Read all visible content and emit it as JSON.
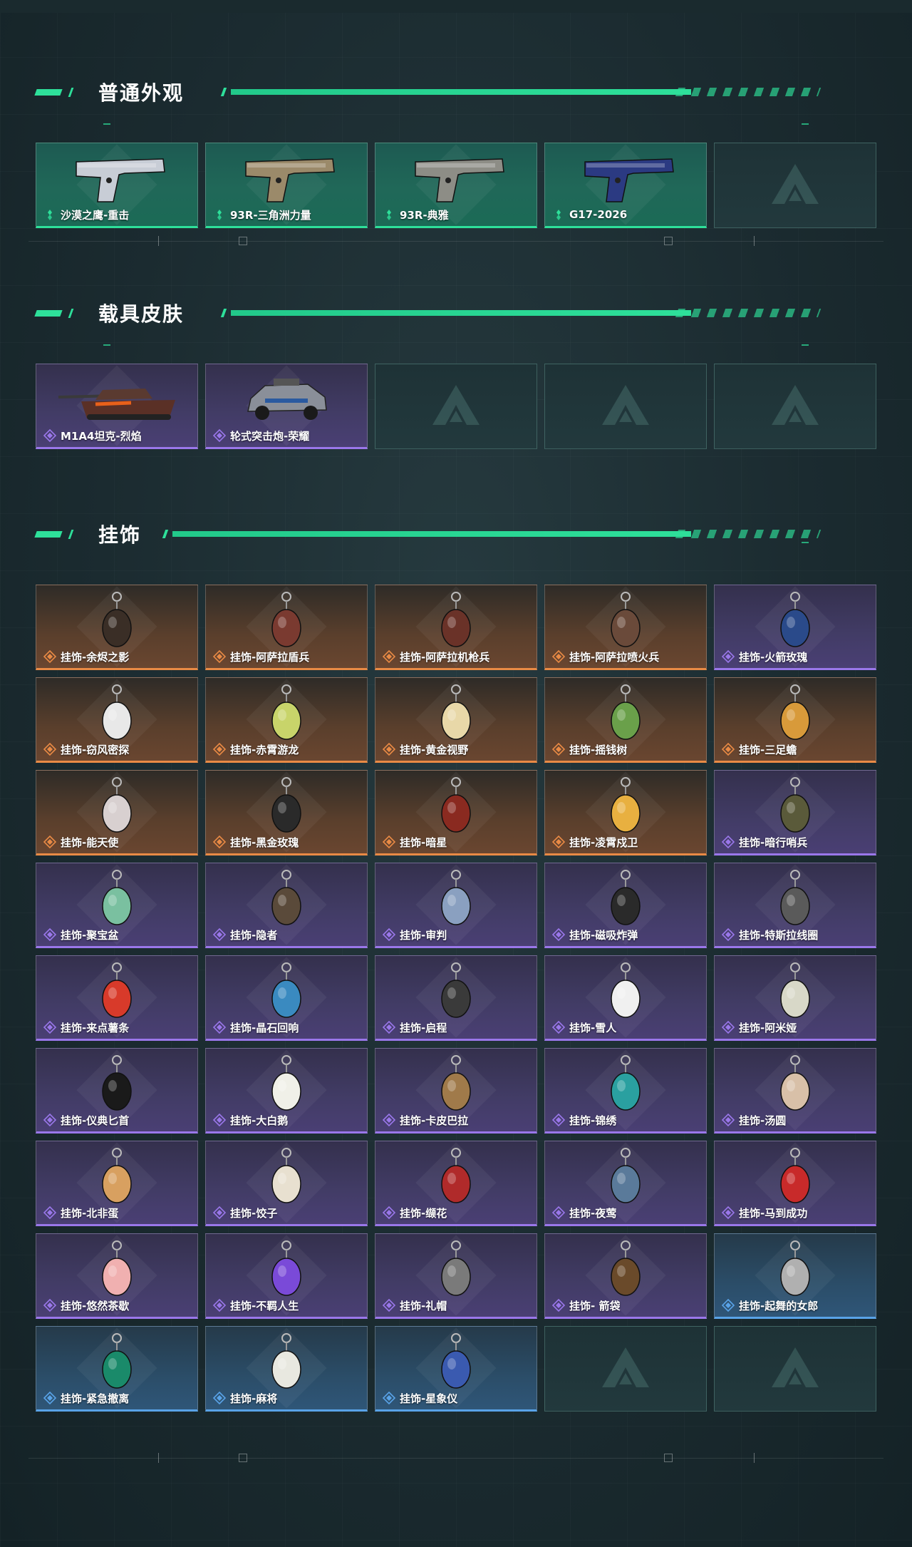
{
  "sections": [
    {
      "title": "普通外观",
      "items": [
        {
          "label": "沙漠之鹰-重击",
          "rarity": "green",
          "icon": "pistol-icon",
          "color": "#c8cdd6"
        },
        {
          "label": "93R-三角洲力量",
          "rarity": "green",
          "icon": "pistol-icon",
          "color": "#9b8a6a"
        },
        {
          "label": "93R-典雅",
          "rarity": "green",
          "icon": "pistol-icon",
          "color": "#8d8d86"
        },
        {
          "label": "G17-2026",
          "rarity": "green",
          "icon": "pistol-icon",
          "color": "#2b3a82"
        },
        {
          "label": "",
          "rarity": "empty",
          "icon": "logo-icon"
        }
      ]
    },
    {
      "title": "载具皮肤",
      "items": [
        {
          "label": "M1A4坦克-烈焰",
          "rarity": "purple",
          "icon": "tank-icon",
          "color": "#5a3a30"
        },
        {
          "label": "轮式突击炮-荣耀",
          "rarity": "purple",
          "icon": "vehicle-icon",
          "color": "#8a8f99"
        },
        {
          "label": "",
          "rarity": "empty",
          "icon": "logo-icon"
        },
        {
          "label": "",
          "rarity": "empty",
          "icon": "logo-icon"
        },
        {
          "label": "",
          "rarity": "empty",
          "icon": "logo-icon"
        }
      ]
    },
    {
      "title": "挂饰",
      "items": [
        {
          "label": "挂饰-余烬之影",
          "rarity": "orange",
          "icon": "charm-icon",
          "color": "#3a2e26"
        },
        {
          "label": "挂饰-阿萨拉盾兵",
          "rarity": "orange",
          "icon": "charm-icon",
          "color": "#7a3a30"
        },
        {
          "label": "挂饰-阿萨拉机枪兵",
          "rarity": "orange",
          "icon": "charm-icon",
          "color": "#6a3228"
        },
        {
          "label": "挂饰-阿萨拉喷火兵",
          "rarity": "orange",
          "icon": "charm-icon",
          "color": "#6a4a3a"
        },
        {
          "label": "挂饰-火箭玫瑰",
          "rarity": "purple",
          "icon": "charm-icon",
          "color": "#2a4a8a"
        },
        {
          "label": "挂饰-窃风密探",
          "rarity": "orange",
          "icon": "charm-icon",
          "color": "#e8e8e8"
        },
        {
          "label": "挂饰-赤霄游龙",
          "rarity": "orange",
          "icon": "charm-icon",
          "color": "#c8d46a"
        },
        {
          "label": "挂饰-黄金视野",
          "rarity": "orange",
          "icon": "charm-icon",
          "color": "#e8d8a8"
        },
        {
          "label": "挂饰-摇钱树",
          "rarity": "orange",
          "icon": "charm-icon",
          "color": "#6aa04a"
        },
        {
          "label": "挂饰-三足蟾",
          "rarity": "orange",
          "icon": "charm-icon",
          "color": "#d89a3a"
        },
        {
          "label": "挂饰-能天使",
          "rarity": "orange",
          "icon": "charm-icon",
          "color": "#d8d0d0"
        },
        {
          "label": "挂饰-黑金玫瑰",
          "rarity": "orange",
          "icon": "charm-icon",
          "color": "#2a2a2a"
        },
        {
          "label": "挂饰-暗星",
          "rarity": "orange",
          "icon": "charm-icon",
          "color": "#8a2a20"
        },
        {
          "label": "挂饰-凌霄戍卫",
          "rarity": "orange",
          "icon": "charm-icon",
          "color": "#e8b040"
        },
        {
          "label": "挂饰-暗行哨兵",
          "rarity": "purple",
          "icon": "charm-icon",
          "color": "#5a5a3a"
        },
        {
          "label": "挂饰-聚宝盆",
          "rarity": "purple",
          "icon": "charm-icon",
          "color": "#7ac0a0"
        },
        {
          "label": "挂饰-隐者",
          "rarity": "purple",
          "icon": "charm-icon",
          "color": "#5a4a3a"
        },
        {
          "label": "挂饰-审判",
          "rarity": "purple",
          "icon": "charm-icon",
          "color": "#8aa0c0"
        },
        {
          "label": "挂饰-磁吸炸弹",
          "rarity": "purple",
          "icon": "charm-icon",
          "color": "#2a2a2a"
        },
        {
          "label": "挂饰-特斯拉线圈",
          "rarity": "purple",
          "icon": "charm-icon",
          "color": "#5a5a5a"
        },
        {
          "label": "挂饰-来点薯条",
          "rarity": "purple",
          "icon": "charm-icon",
          "color": "#d83a2a"
        },
        {
          "label": "挂饰-晶石回响",
          "rarity": "purple",
          "icon": "charm-icon",
          "color": "#3a8ac0"
        },
        {
          "label": "挂饰-启程",
          "rarity": "purple",
          "icon": "charm-icon",
          "color": "#3a3a3a"
        },
        {
          "label": "挂饰-雪人",
          "rarity": "purple",
          "icon": "charm-icon",
          "color": "#f0f0f0"
        },
        {
          "label": "挂饰-阿米娅",
          "rarity": "purple",
          "icon": "charm-icon",
          "color": "#d8d8c8"
        },
        {
          "label": "挂饰-仪典匕首",
          "rarity": "purple",
          "icon": "charm-icon",
          "color": "#1a1a1a"
        },
        {
          "label": "挂饰-大白鹅",
          "rarity": "purple",
          "icon": "charm-icon",
          "color": "#f0f0e8"
        },
        {
          "label": "挂饰-卡皮巴拉",
          "rarity": "purple",
          "icon": "charm-icon",
          "color": "#a07a4a"
        },
        {
          "label": "挂饰-锦绣",
          "rarity": "purple",
          "icon": "charm-icon",
          "color": "#2aa0a0"
        },
        {
          "label": "挂饰-汤圆",
          "rarity": "purple",
          "icon": "charm-icon",
          "color": "#d8c0a8"
        },
        {
          "label": "挂饰-北非蛋",
          "rarity": "purple",
          "icon": "charm-icon",
          "color": "#d8a060"
        },
        {
          "label": "挂饰-饺子",
          "rarity": "purple",
          "icon": "charm-icon",
          "color": "#e8e0d0"
        },
        {
          "label": "挂饰-缬花",
          "rarity": "purple",
          "icon": "charm-icon",
          "color": "#b02a2a"
        },
        {
          "label": "挂饰-夜莺",
          "rarity": "purple",
          "icon": "charm-icon",
          "color": "#5a7a9a"
        },
        {
          "label": "挂饰-马到成功",
          "rarity": "purple",
          "icon": "charm-icon",
          "color": "#c82a2a"
        },
        {
          "label": "挂饰-悠然茶歇",
          "rarity": "purple",
          "icon": "charm-icon",
          "color": "#f0b0b0"
        },
        {
          "label": "挂饰-不羁人生",
          "rarity": "purple",
          "icon": "charm-icon",
          "color": "#7a4ad8"
        },
        {
          "label": "挂饰-礼帽",
          "rarity": "purple",
          "icon": "charm-icon",
          "color": "#7a7a7a"
        },
        {
          "label": "挂饰- 箭袋",
          "rarity": "purple",
          "icon": "charm-icon",
          "color": "#6a4a2a"
        },
        {
          "label": "挂饰-起舞的女郎",
          "rarity": "blue",
          "icon": "charm-icon",
          "color": "#b0b0b0"
        },
        {
          "label": "挂饰-紧急撤离",
          "rarity": "blue",
          "icon": "charm-icon",
          "color": "#1a8a6a"
        },
        {
          "label": "挂饰-麻将",
          "rarity": "blue",
          "icon": "charm-icon",
          "color": "#e8e8e0"
        },
        {
          "label": "挂饰-星象仪",
          "rarity": "blue",
          "icon": "charm-icon",
          "color": "#3a5ab0"
        },
        {
          "label": "",
          "rarity": "empty",
          "icon": "logo-icon"
        },
        {
          "label": "",
          "rarity": "empty",
          "icon": "logo-icon"
        }
      ]
    }
  ],
  "colors": {
    "accent": "#2ee09a",
    "green": "#2ee09a",
    "purple": "#9a77ea",
    "orange": "#e98a45",
    "blue": "#59a3e8"
  }
}
